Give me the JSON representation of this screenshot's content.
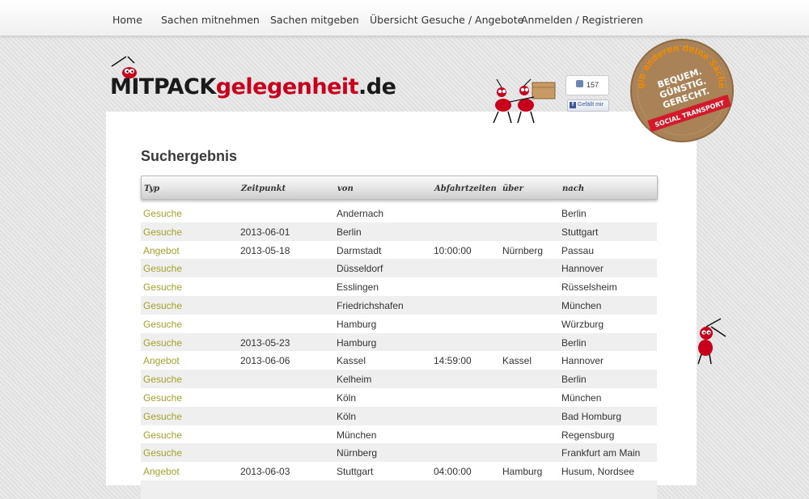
{
  "nav": {
    "home": "Home",
    "mitnehmen": "Sachen mitnehmen",
    "mitgeben": "Sachen mitgeben",
    "uebersicht": "Übersicht Gesuche / Angebote",
    "anmelden": "Anmelden / Registrieren"
  },
  "logo": {
    "part1": "MITPACK",
    "part2": "gelegenheit",
    "part3": ".de"
  },
  "facebook": {
    "count": "157",
    "like_label": "Gefällt mir"
  },
  "badge": {
    "arc_text": "gib anderen deine Sachen mit",
    "line1": "BEQUEM.",
    "line2": "GÜNSTIG.",
    "line3": "GERECHT.",
    "ribbon": "SOCIAL TRANSPORT"
  },
  "page_title": "Suchergebnis",
  "table": {
    "headers": {
      "typ": "Typ",
      "zeitpunkt": "Zeitpunkt",
      "von": "von",
      "abfahrt": "Abfahrtzeiten",
      "ueber": "über",
      "nach": "nach"
    },
    "rows": [
      {
        "typ": "Gesuche",
        "zeit": "",
        "von": "Andernach",
        "ab": "",
        "ueber": "",
        "nach": "Berlin"
      },
      {
        "typ": "Gesuche",
        "zeit": "2013-06-01",
        "von": "Berlin",
        "ab": "",
        "ueber": "",
        "nach": "Stuttgart"
      },
      {
        "typ": "Angebot",
        "zeit": "2013-05-18",
        "von": "Darmstadt",
        "ab": "10:00:00",
        "ueber": "Nürnberg",
        "nach": "Passau"
      },
      {
        "typ": "Gesuche",
        "zeit": "",
        "von": "Düsseldorf",
        "ab": "",
        "ueber": "",
        "nach": "Hannover"
      },
      {
        "typ": "Gesuche",
        "zeit": "",
        "von": "Esslingen",
        "ab": "",
        "ueber": "",
        "nach": "Rüsselsheim"
      },
      {
        "typ": "Gesuche",
        "zeit": "",
        "von": "Friedrichshafen",
        "ab": "",
        "ueber": "",
        "nach": "München"
      },
      {
        "typ": "Gesuche",
        "zeit": "",
        "von": "Hamburg",
        "ab": "",
        "ueber": "",
        "nach": "Würzburg"
      },
      {
        "typ": "Gesuche",
        "zeit": "2013-05-23",
        "von": "Hamburg",
        "ab": "",
        "ueber": "",
        "nach": "Berlin"
      },
      {
        "typ": "Angebot",
        "zeit": "2013-06-06",
        "von": "Kassel",
        "ab": "14:59:00",
        "ueber": "Kassel",
        "nach": "Hannover"
      },
      {
        "typ": "Gesuche",
        "zeit": "",
        "von": "Kelheim",
        "ab": "",
        "ueber": "",
        "nach": "Berlin"
      },
      {
        "typ": "Gesuche",
        "zeit": "",
        "von": "Köln",
        "ab": "",
        "ueber": "",
        "nach": "München"
      },
      {
        "typ": "Gesuche",
        "zeit": "",
        "von": "Köln",
        "ab": "",
        "ueber": "",
        "nach": "Bad Homburg"
      },
      {
        "typ": "Gesuche",
        "zeit": "",
        "von": "München",
        "ab": "",
        "ueber": "",
        "nach": "Regensburg"
      },
      {
        "typ": "Gesuche",
        "zeit": "",
        "von": "Nürnberg",
        "ab": "",
        "ueber": "",
        "nach": "Frankfurt am Main"
      },
      {
        "typ": "Angebot",
        "zeit": "2013-06-03",
        "von": "Stuttgart",
        "ab": "04:00:00",
        "ueber": "Hamburg",
        "nach": "Husum, Nordsee"
      },
      {
        "typ": "",
        "zeit": "",
        "von": "",
        "ab": "",
        "ueber": "",
        "nach": ""
      }
    ]
  },
  "colors": {
    "link": "#a3a32a",
    "brand_red": "#c8001c",
    "badge_brown": "#a98257",
    "badge_orange": "#f08a00"
  },
  "icons": [
    "ant-logo-icon",
    "ants-with-box-icon",
    "like-thumb-icon",
    "facebook-icon",
    "ant-mascot-icon"
  ]
}
